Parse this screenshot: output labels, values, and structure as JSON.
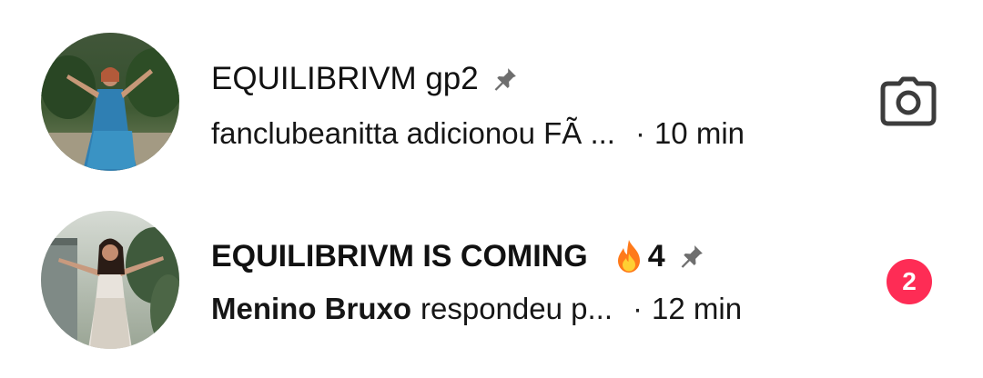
{
  "colors": {
    "badge": "#fe2c55",
    "pin": "#6e6e6e",
    "camera": "#3c3c3c",
    "text": "#161616"
  },
  "conversations": [
    {
      "name": "EQUILIBRIVM gp2",
      "pinned": true,
      "preview": "fanclubeanitta adicionou FÃ ...",
      "time": "10 min",
      "action_icon": "camera-icon"
    },
    {
      "name": "EQUILIBRIVM IS COMING",
      "streak_icon": "fire-icon",
      "streak_count": "4",
      "pinned": true,
      "preview_sender": "Menino Bruxo",
      "preview": "respondeu p...",
      "time": "12 min",
      "unread_count": "2"
    }
  ],
  "separator": "·"
}
